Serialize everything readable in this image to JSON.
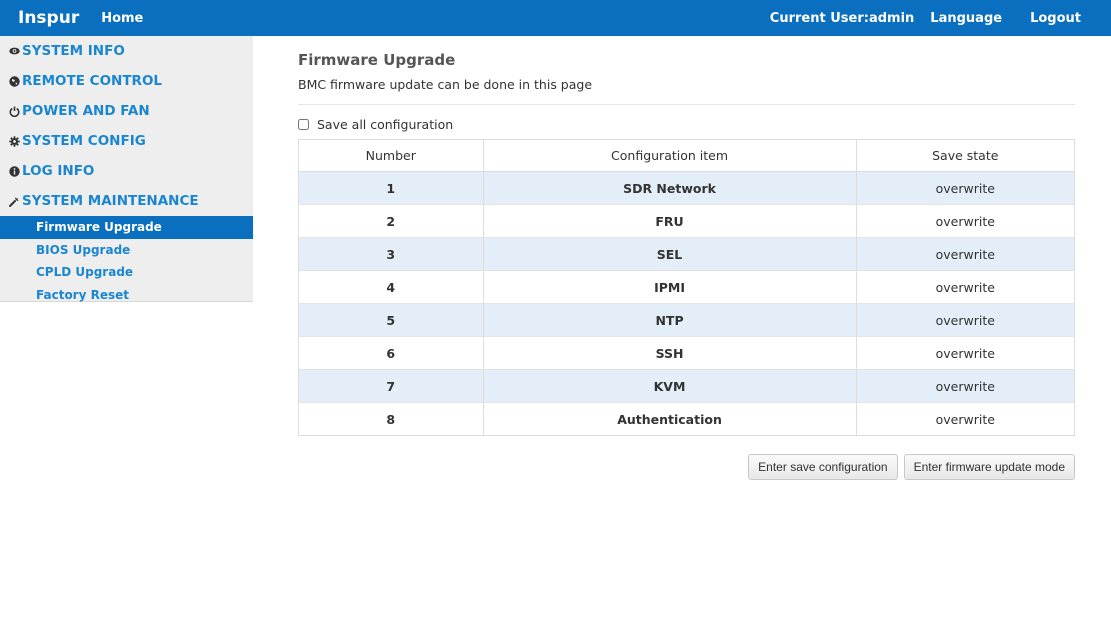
{
  "header": {
    "brand": "Inspur",
    "home": "Home",
    "current_user": "Current User:admin",
    "language": "Language",
    "logout": "Logout"
  },
  "sidebar": {
    "sections": [
      {
        "label": "SYSTEM INFO",
        "icon": "eye-icon"
      },
      {
        "label": "REMOTE CONTROL",
        "icon": "globe-icon"
      },
      {
        "label": "POWER AND FAN",
        "icon": "power-icon"
      },
      {
        "label": "SYSTEM CONFIG",
        "icon": "gear-icon"
      },
      {
        "label": "LOG INFO",
        "icon": "info-icon"
      },
      {
        "label": "SYSTEM MAINTENANCE",
        "icon": "wrench-icon"
      }
    ],
    "maintenance_items": [
      {
        "label": "Firmware Upgrade",
        "active": true
      },
      {
        "label": "BIOS Upgrade",
        "active": false
      },
      {
        "label": "CPLD Upgrade",
        "active": false
      },
      {
        "label": "Factory Reset",
        "active": false
      }
    ]
  },
  "main": {
    "title": "Firmware Upgrade",
    "description": "BMC firmware update can be done in this page",
    "save_all_label": "Save all configuration",
    "save_all_checked": false,
    "table": {
      "headers": [
        "Number",
        "Configuration item",
        "Save state"
      ],
      "rows": [
        [
          "1",
          "SDR Network",
          "overwrite"
        ],
        [
          "2",
          "FRU",
          "overwrite"
        ],
        [
          "3",
          "SEL",
          "overwrite"
        ],
        [
          "4",
          "IPMI",
          "overwrite"
        ],
        [
          "5",
          "NTP",
          "overwrite"
        ],
        [
          "6",
          "SSH",
          "overwrite"
        ],
        [
          "7",
          "KVM",
          "overwrite"
        ],
        [
          "8",
          "Authentication",
          "overwrite"
        ]
      ]
    },
    "buttons": {
      "save_config": "Enter save configuration",
      "firmware_update": "Enter firmware update mode"
    }
  },
  "colors": {
    "header_bg": "#0a6fbf",
    "link": "#1a86d0",
    "row_stripe": "#e3eef8"
  }
}
